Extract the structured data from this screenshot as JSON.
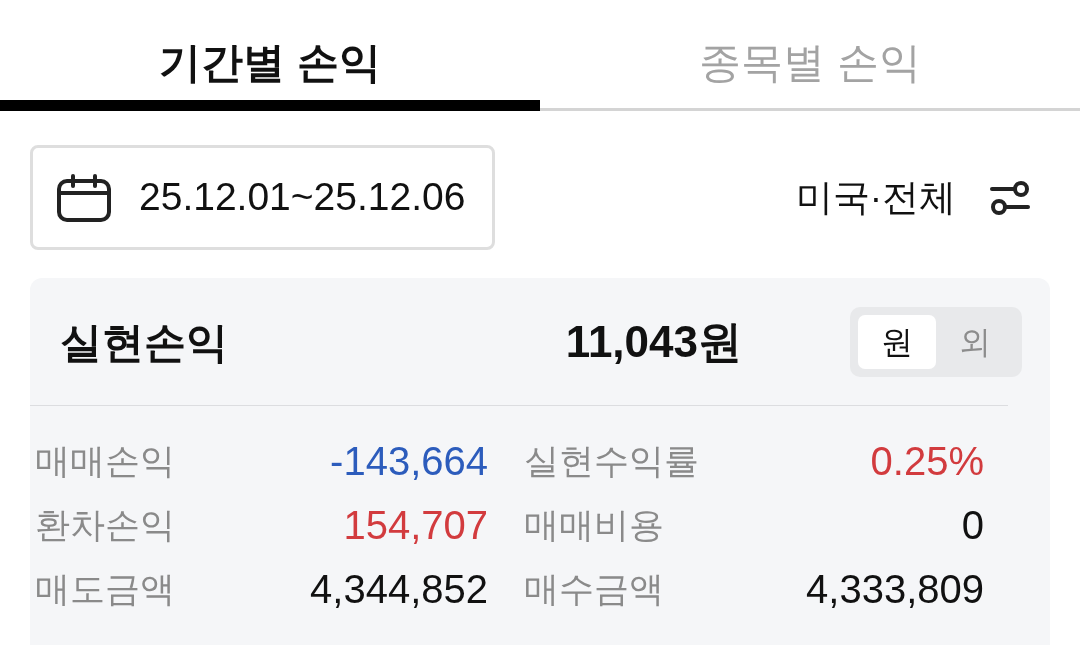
{
  "tabs": [
    {
      "label": "기간별 손익",
      "selected": true
    },
    {
      "label": "종목별 손익",
      "selected": false
    }
  ],
  "date_range": {
    "value": "25.12.01~25.12.06"
  },
  "market_filter": {
    "label": "미국·전체"
  },
  "summary": {
    "title": "실현손익",
    "total": "11,043원",
    "currency_toggle": [
      {
        "label": "원",
        "selected": true
      },
      {
        "label": "외",
        "selected": false
      }
    ],
    "stats": [
      {
        "label": "매매손익",
        "value": "-143,664",
        "color": "#2c5cbc"
      },
      {
        "label": "실현수익률",
        "value": "0.25%",
        "color": "#d23b3e"
      },
      {
        "label": "환차손익",
        "value": "154,707",
        "color": "#d23b3e"
      },
      {
        "label": "매매비용",
        "value": "0",
        "color": "#111111"
      },
      {
        "label": "매도금액",
        "value": "4,344,852",
        "color": "#111111"
      },
      {
        "label": "매수금액",
        "value": "4,333,809",
        "color": "#111111"
      }
    ]
  }
}
